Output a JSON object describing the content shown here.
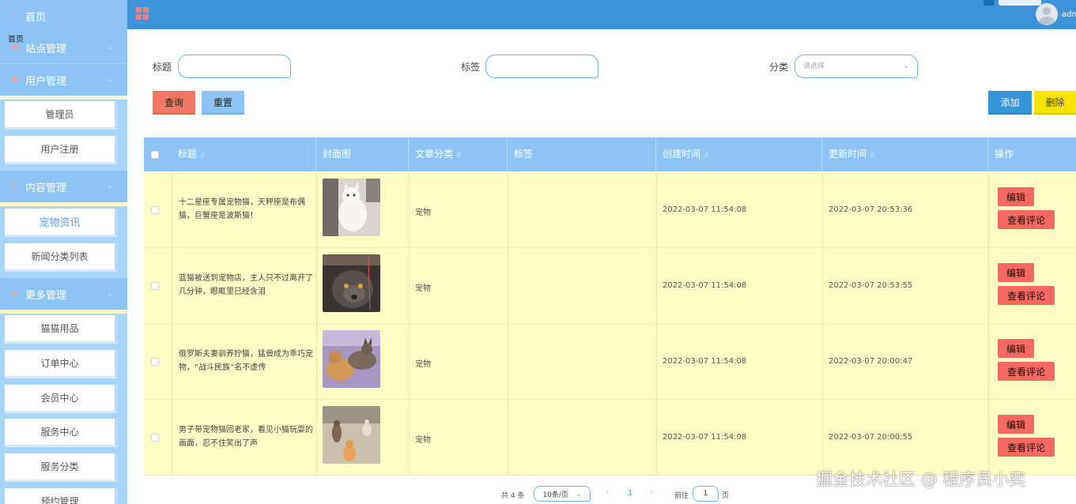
{
  "sidebar": {
    "home": "首页",
    "overlay": "首页",
    "groups": [
      {
        "label": "站点管理",
        "items": []
      },
      {
        "label": "用户管理",
        "items": [
          "管理员",
          "用户注册"
        ]
      },
      {
        "label": "内容管理",
        "items": [
          "宠物资讯",
          "新闻分类列表"
        ]
      },
      {
        "label": "更多管理",
        "items": [
          "猫猫用品",
          "订单中心",
          "会员中心",
          "服务中心",
          "服务分类",
          "预约管理"
        ]
      }
    ]
  },
  "header": {
    "user_name": "adm"
  },
  "search": {
    "title_label": "标题",
    "title_value": "",
    "tag_label": "标签",
    "tag_value": "",
    "category_label": "分类",
    "category_placeholder": "请选择",
    "query_button": "查询",
    "reset_button": "重置"
  },
  "actions": {
    "add_button": "添加",
    "delete_button": "删除"
  },
  "table": {
    "columns": [
      "标题",
      "封面图",
      "文章分类",
      "标签",
      "创建时间",
      "更新时间",
      "操作"
    ],
    "rows": [
      {
        "title": "十二星座专属宠物猫，天秤座是布偶猫，巨蟹座是波斯猫！",
        "category": "宠物",
        "tag": "",
        "created": "2022-03-07 11:54:08",
        "updated": "2022-03-07 20:53:36"
      },
      {
        "title": "蓝猫被送到宠物店，主人只不过离开了几分钟，眼眶里已经含泪",
        "category": "宠物",
        "tag": "",
        "created": "2022-03-07 11:54:08",
        "updated": "2022-03-07 20:53:55"
      },
      {
        "title": "俄罗斯夫妻驯养狞猫，猛兽成为乖巧宠物，“战斗民族”名不虚传",
        "category": "宠物",
        "tag": "",
        "created": "2022-03-07 11:54:08",
        "updated": "2022-03-07 20:00:47"
      },
      {
        "title": "男子带宠物猫回老家，看见小猫玩耍的画面，忍不住笑出了声",
        "category": "宠物",
        "tag": "",
        "created": "2022-03-07 11:54:08",
        "updated": "2022-03-07 20:00:55"
      }
    ],
    "edit_label": "编辑",
    "comments_label": "查看评论"
  },
  "pagination": {
    "total": "共 4 条",
    "page_size": "10条/页",
    "current": "1",
    "goto_prefix": "前往",
    "goto_value": "1",
    "goto_suffix": "页"
  },
  "watermark": "掘金技术社区 @ 程序员小奕",
  "colors": {
    "header": "#3d94d8",
    "sidebar": "#8cc4f8",
    "row_bg": "#fffcc4",
    "danger": "#f46a62",
    "warning": "#f7e400"
  }
}
